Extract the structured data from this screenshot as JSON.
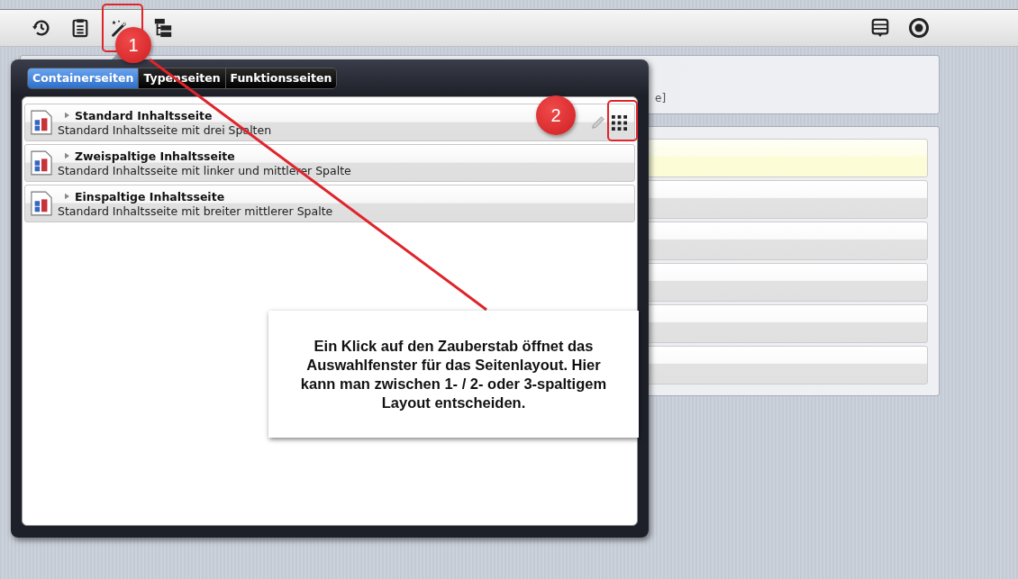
{
  "popup": {
    "tabs": [
      {
        "label": "Containerseiten",
        "selected": true
      },
      {
        "label": "Typenseiten",
        "selected": false
      },
      {
        "label": "Funktionsseiten",
        "selected": false
      }
    ],
    "templates": [
      {
        "title": "Standard Inhaltsseite",
        "description": "Standard Inhaltsseite mit drei Spalten",
        "actions_shown": true
      },
      {
        "title": "Zweispaltige Inhaltsseite",
        "description": "Standard Inhaltsseite mit linker und mittlerer Spalte",
        "actions_shown": false
      },
      {
        "title": "Einspaltige Inhaltsseite",
        "description": "Standard Inhaltsseite mit breiter mittlerer Spalte",
        "actions_shown": false
      }
    ]
  },
  "background": {
    "header_text": "e]",
    "rows": [
      {
        "highlighted": true
      },
      {
        "highlighted": false
      },
      {
        "highlighted": false
      },
      {
        "highlighted": false
      },
      {
        "highlighted": false
      },
      {
        "highlighted": false
      }
    ]
  },
  "annotations": {
    "markers": [
      "1",
      "2"
    ],
    "callout": "Ein Klick auf den Zauberstab öffnet das Auswahlfenster für das Seitenlayout. Hier kann man zwischen 1- / 2- oder 3-spaltigem Layout entscheiden."
  }
}
